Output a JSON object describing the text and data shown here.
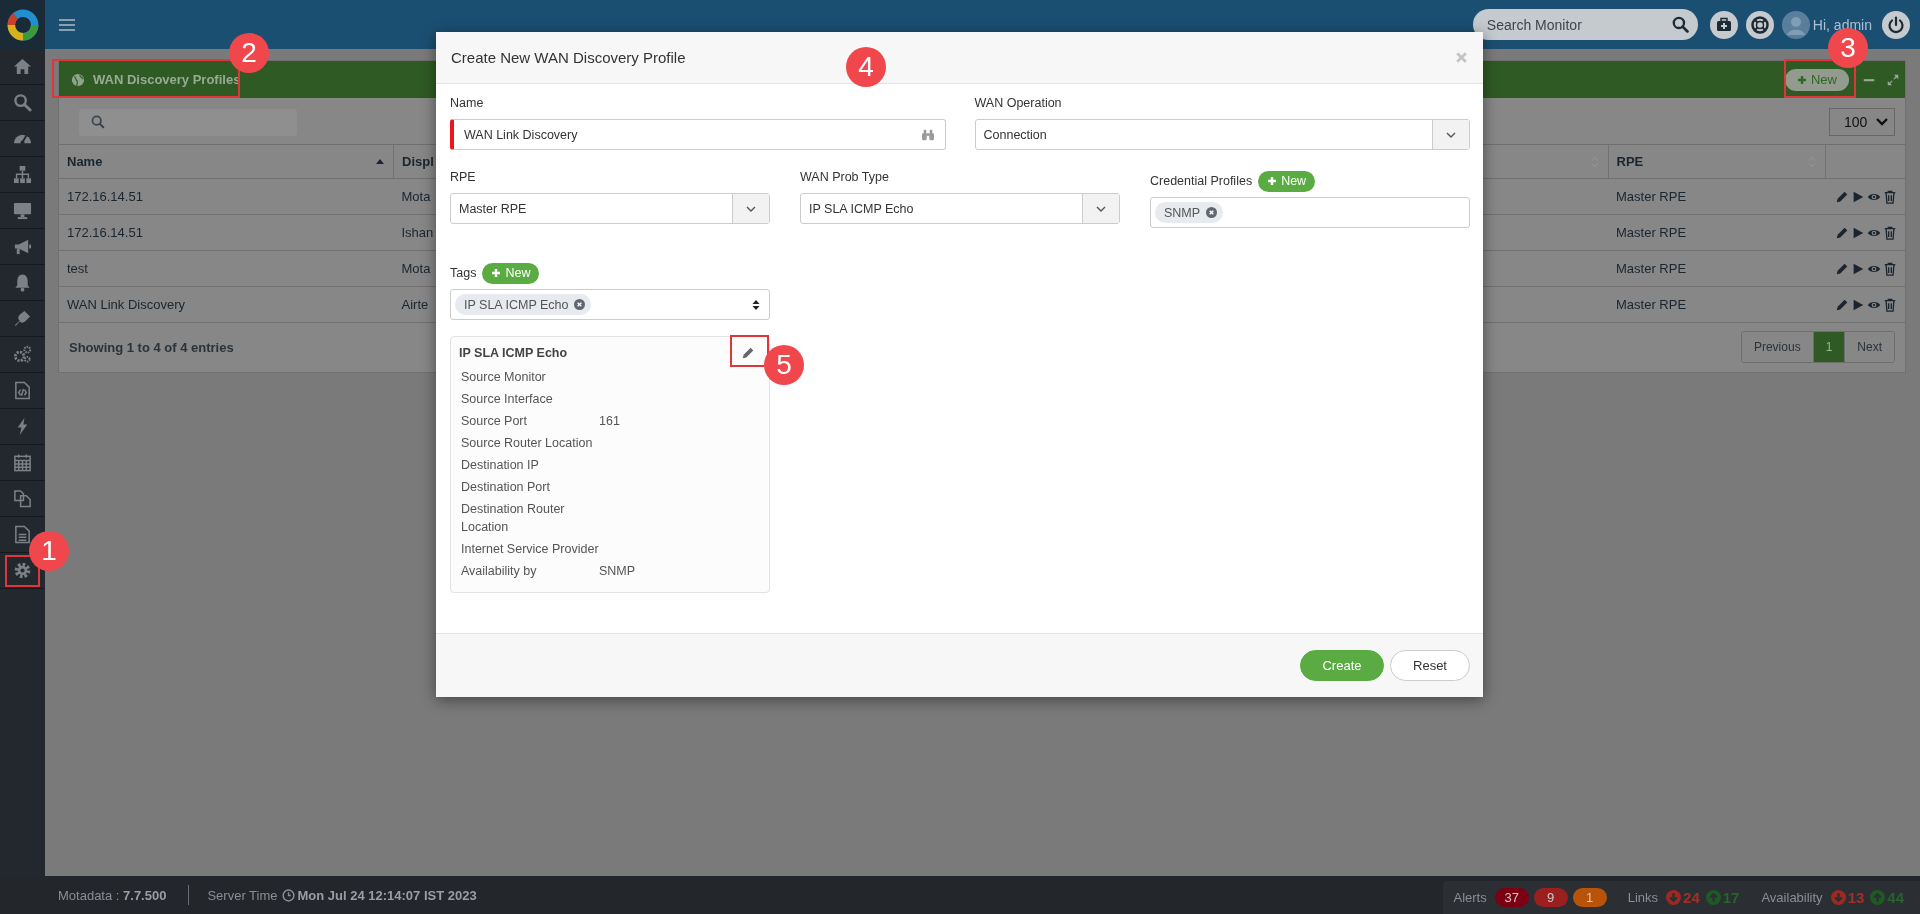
{
  "top_bar": {
    "search": {
      "placeholder": "Search Monitor"
    },
    "greeting": "Hi, admin"
  },
  "panel": {
    "title": "WAN Discovery Profiles",
    "new_button": "New",
    "page_size": "100",
    "table": {
      "columns": [
        {
          "label": "Name",
          "sorted": true
        },
        {
          "label": "Displ"
        },
        {
          "sorted": false
        },
        {
          "label": "RPE",
          "sorted": false
        }
      ],
      "rows": [
        {
          "name": "172.16.14.51",
          "column_2": "Mota",
          "rpe": "Master RPE"
        },
        {
          "name": "172.16.14.51",
          "column_2": "Ishan",
          "rpe": "Master RPE"
        },
        {
          "name": "test",
          "column_2": "Mota",
          "rpe": "Master RPE"
        },
        {
          "name": "WAN Link Discovery",
          "column_2": "Airte",
          "rpe": "Master RPE"
        }
      ],
      "info": "Showing 1 to 4 of 4 entries",
      "pagination": [
        {
          "label": "Previous",
          "selected": false
        },
        {
          "label": "1",
          "selected": true
        },
        {
          "label": "Next",
          "selected": false
        }
      ]
    }
  },
  "modal": {
    "title": "Create New WAN Discovery Profile",
    "name": {
      "label": "Name",
      "value": "WAN Link Discovery",
      "required": true
    },
    "wan_operation": {
      "label": "WAN Operation",
      "value": "Connection"
    },
    "rpe": {
      "label": "RPE",
      "value": "Master RPE"
    },
    "wan_prob_type": {
      "label": "WAN Prob Type",
      "value": "IP SLA ICMP Echo"
    },
    "credential_profiles": {
      "label": "Credential Profiles",
      "new_button": "New",
      "tags": [
        "SNMP"
      ]
    },
    "tags": {
      "label": "Tags",
      "new_button": "New",
      "tags": [
        "IP SLA ICMP Echo"
      ]
    },
    "probe_card": {
      "title": "IP SLA ICMP Echo",
      "rows": [
        {
          "label": "Source Monitor"
        },
        {
          "label": "Source Interface"
        },
        {
          "label": "Source Port",
          "value": "161"
        },
        {
          "label": "Source Router Location"
        },
        {
          "label": "Destination IP"
        },
        {
          "label": "Destination Port"
        },
        {
          "label": "Destination Router Location"
        },
        {
          "label": "Internet Service Provider"
        },
        {
          "label": "Availability by",
          "value": "SNMP"
        }
      ]
    },
    "buttons": [
      {
        "label": "Create",
        "kind": "primary"
      },
      {
        "label": "Reset",
        "kind": "secondary"
      }
    ]
  },
  "status_bar": {
    "version": "Motadata : **7.7.500**",
    "server_time_label": "Server Time",
    "server_time": "Mon Jul 24 12:14:07 IST 2023",
    "alerts": {
      "label": "Alerts",
      "badges": [
        {
          "count": "37",
          "color": "#7a0012"
        },
        {
          "count": "9",
          "color": "#9c1f1f"
        },
        {
          "count": "1",
          "color": "#b85308"
        }
      ]
    },
    "links": {
      "label": "Links",
      "down": "24",
      "up": "17"
    },
    "availability": {
      "label": "Availability",
      "down": "13",
      "up": "44"
    }
  },
  "annotations": [
    {
      "number": "1",
      "framed": true
    },
    {
      "number": "2",
      "framed": true
    },
    {
      "number": "3",
      "framed": true
    },
    {
      "number": "4",
      "framed": false
    },
    {
      "number": "5",
      "framed": true
    }
  ]
}
